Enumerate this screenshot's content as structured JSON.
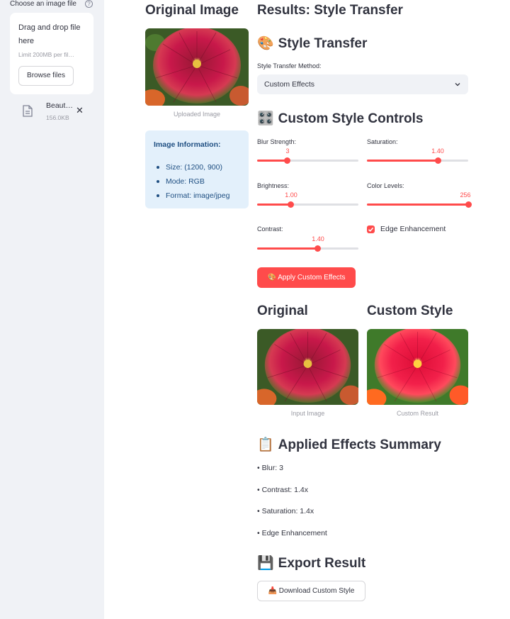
{
  "sidebar": {
    "uploader_label": "Choose an image file",
    "help_glyph": "?",
    "dropzone_title": "Drag and drop file here",
    "dropzone_limit": "Limit 200MB per fil…",
    "browse_label": "Browse files",
    "file": {
      "name": "Beaut…",
      "size": "156.0KB",
      "remove_glyph": "✕"
    }
  },
  "left_column": {
    "title": "Original Image",
    "image_caption": "Uploaded Image",
    "info": {
      "title": "Image Information:",
      "items": [
        "Size: (1200, 900)",
        "Mode: RGB",
        "Format: image/jpeg"
      ]
    }
  },
  "results": {
    "title": "Results: Style Transfer",
    "style_transfer": {
      "emoji": "🎨",
      "heading": "Style Transfer",
      "method_label": "Style Transfer Method:",
      "method_value": "Custom Effects"
    },
    "controls": {
      "emoji": "🎛️",
      "heading": "Custom Style Controls",
      "blur": {
        "label": "Blur Strength:",
        "value": "3",
        "fraction": 0.3
      },
      "saturation": {
        "label": "Saturation:",
        "value": "1.40",
        "fraction": 0.7
      },
      "brightness": {
        "label": "Brightness:",
        "value": "1.00",
        "fraction": 0.33
      },
      "color_levels": {
        "label": "Color Levels:",
        "value": "256",
        "fraction": 1.0
      },
      "contrast": {
        "label": "Contrast:",
        "value": "1.40",
        "fraction": 0.6
      },
      "edge_label": "Edge Enhancement",
      "edge_checked": true,
      "apply_label": "🎨 Apply Custom Effects"
    },
    "compare": {
      "original_heading": "Original",
      "original_caption": "Input Image",
      "custom_heading": "Custom Style",
      "custom_caption": "Custom Result"
    },
    "summary": {
      "emoji": "📋",
      "heading": "Applied Effects Summary",
      "items": [
        "• Blur: 3",
        "• Contrast: 1.4x",
        "• Saturation: 1.4x",
        "• Edge Enhancement"
      ]
    },
    "export": {
      "emoji": "💾",
      "heading": "Export Result",
      "download_label": "📥 Download Custom Style"
    }
  },
  "colors": {
    "accent": "#ff4b4b",
    "sidebar_bg": "#f0f2f6",
    "info_bg": "#e3f0fb",
    "info_text": "#1f4f82"
  }
}
